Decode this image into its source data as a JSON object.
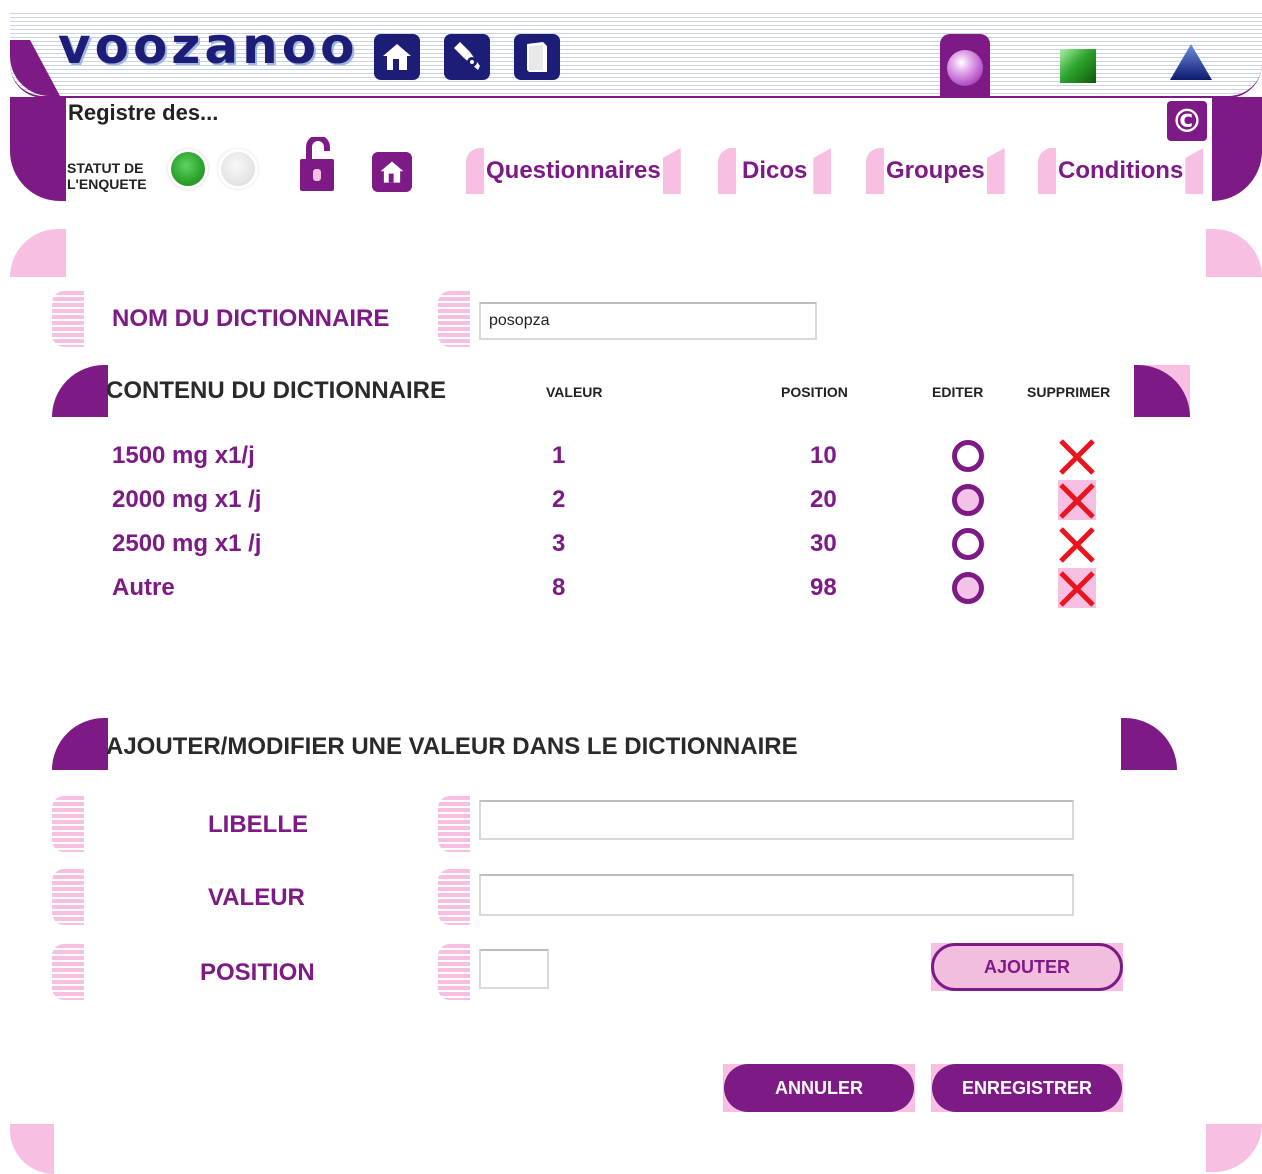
{
  "header": {
    "logo_text": "voozanoo",
    "nav_icons": [
      "home-icon",
      "tools-icon",
      "book-icon"
    ],
    "right_icons": [
      "sphere-icon",
      "green-square-icon",
      "triangle-icon"
    ]
  },
  "topbar": {
    "title": "Registre des...",
    "statut_label_line1": "STATUT DE",
    "statut_label_line2": "L'ENQUETE",
    "copyright_symbol": "©",
    "tabs": [
      {
        "label": "Questionnaires"
      },
      {
        "label": "Dicos"
      },
      {
        "label": "Groupes"
      },
      {
        "label": "Conditions"
      }
    ]
  },
  "dictionary": {
    "name_label": "NOM DU DICTIONNAIRE",
    "name_value": "posopza",
    "content_title": "CONTENU DU DICTIONNAIRE",
    "columns": {
      "valeur": "VALEUR",
      "position": "POSITION",
      "editer": "EDITER",
      "supprimer": "SUPPRIMER"
    },
    "rows": [
      {
        "libelle": "1500 mg x1/j",
        "valeur": "1",
        "position": "10"
      },
      {
        "libelle": "2000 mg x1 /j",
        "valeur": "2",
        "position": "20"
      },
      {
        "libelle": "2500 mg x1 /j",
        "valeur": "3",
        "position": "30"
      },
      {
        "libelle": "Autre",
        "valeur": "8",
        "position": "98"
      }
    ]
  },
  "add_form": {
    "title": "AJOUTER/MODIFIER UNE VALEUR DANS LE DICTIONNAIRE",
    "libelle_label": "LIBELLE",
    "libelle_value": "",
    "valeur_label": "VALEUR",
    "valeur_value": "",
    "position_label": "POSITION",
    "position_value": "",
    "ajouter_label": "AJOUTER"
  },
  "actions": {
    "annuler_label": "ANNULER",
    "enregistrer_label": "ENREGISTRER"
  },
  "colors": {
    "brand_purple": "#7d1a86",
    "pink": "#f7c0e2",
    "navy": "#1d1d78",
    "delete_red": "#e8141e"
  }
}
